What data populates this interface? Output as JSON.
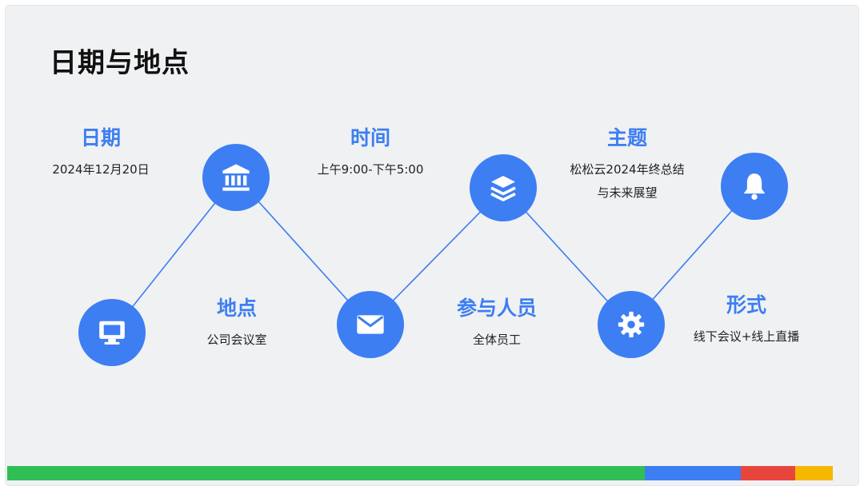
{
  "title": "日期与地点",
  "items": [
    {
      "title": "日期",
      "detail": "2024年12月20日",
      "icon": "monitor-icon"
    },
    {
      "title": "地点",
      "detail": "公司会议室",
      "icon": "bank-icon"
    },
    {
      "title": "时间",
      "detail": "上午9:00-下午5:00",
      "icon": "mail-icon"
    },
    {
      "title": "参与人员",
      "detail": "全体员工",
      "icon": "layers-icon"
    },
    {
      "title": "主题",
      "detail_lines": [
        "松松云2024年终总结",
        "与未来展望"
      ],
      "icon": "gear-icon"
    },
    {
      "title": "形式",
      "detail": "线下会议+线上直播",
      "icon": "bell-icon"
    }
  ],
  "colors": {
    "accent": "#3d7ef2",
    "background": "#f0f1f3",
    "bar_green": "#2fbf55",
    "bar_blue": "#3d7ef2",
    "bar_red": "#e8453c",
    "bar_yellow": "#f5b800"
  }
}
